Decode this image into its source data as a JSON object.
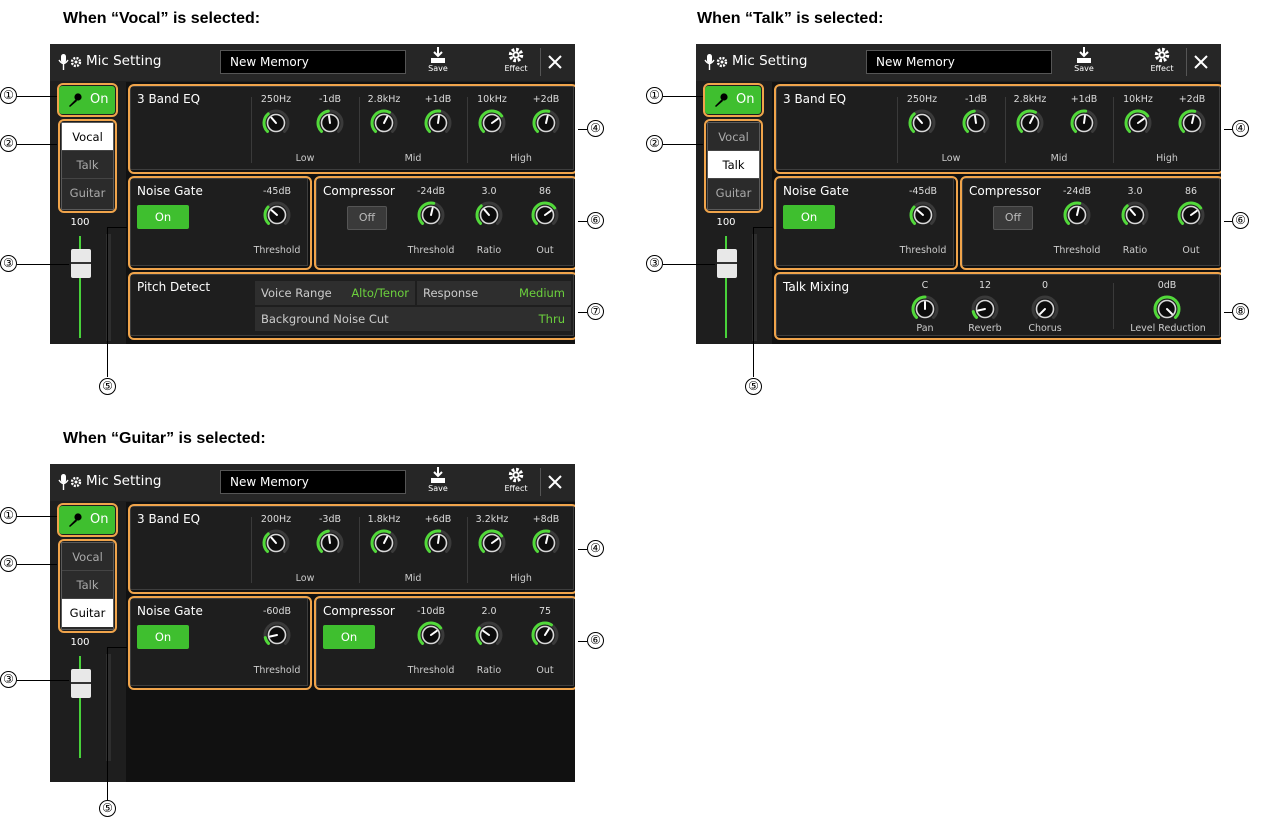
{
  "captions": {
    "vocal": "When “Vocal” is selected:",
    "talk": "When “Talk” is selected:",
    "guitar": "When “Guitar” is selected:"
  },
  "common": {
    "app_title": "Mic Setting",
    "memory_name": "New Memory",
    "save_label": "Save",
    "effect_label": "Effect",
    "mic_on_label": "On",
    "types": [
      "Vocal",
      "Talk",
      "Guitar"
    ],
    "volume_value": "100",
    "eq_title": "3 Band EQ",
    "eq_bands": [
      "Low",
      "Mid",
      "High"
    ],
    "noise_gate_title": "Noise Gate",
    "threshold_label": "Threshold",
    "compressor_title": "Compressor",
    "ratio_label": "Ratio",
    "out_label": "Out"
  },
  "callouts": [
    "①",
    "②",
    "③",
    "④",
    "⑤",
    "⑥",
    "⑦",
    "⑧"
  ],
  "screens": {
    "vocal": {
      "selected_type": "Vocal",
      "eq": [
        "250Hz",
        "-1dB",
        "2.8kHz",
        "+1dB",
        "10kHz",
        "+2dB"
      ],
      "noise_gate": {
        "state": "On",
        "threshold": "-45dB"
      },
      "compressor": {
        "state": "Off",
        "threshold": "-24dB",
        "ratio": "3.0",
        "out": "86"
      },
      "pitch_detect": {
        "title": "Pitch Detect",
        "voice_range_label": "Voice Range",
        "voice_range_value": "Alto/Tenor",
        "response_label": "Response",
        "response_value": "Medium",
        "noise_cut_label": "Background Noise Cut",
        "noise_cut_value": "Thru"
      }
    },
    "talk": {
      "selected_type": "Talk",
      "eq": [
        "250Hz",
        "-1dB",
        "2.8kHz",
        "+1dB",
        "10kHz",
        "+2dB"
      ],
      "noise_gate": {
        "state": "On",
        "threshold": "-45dB"
      },
      "compressor": {
        "state": "Off",
        "threshold": "-24dB",
        "ratio": "3.0",
        "out": "86"
      },
      "talk_mixing": {
        "title": "Talk Mixing",
        "pan": "C",
        "pan_label": "Pan",
        "reverb": "12",
        "reverb_label": "Reverb",
        "chorus": "0",
        "chorus_label": "Chorus",
        "level_reduction": "0dB",
        "level_reduction_label": "Level Reduction"
      }
    },
    "guitar": {
      "selected_type": "Guitar",
      "eq": [
        "200Hz",
        "-3dB",
        "1.8kHz",
        "+6dB",
        "3.2kHz",
        "+8dB"
      ],
      "noise_gate": {
        "state": "On",
        "threshold": "-60dB"
      },
      "compressor": {
        "state": "On",
        "threshold": "-10dB",
        "ratio": "2.0",
        "out": "75"
      }
    }
  },
  "colors": {
    "accent_green": "#3fbf2f",
    "highlight_orange": "#f0a44b",
    "screen_bg": "#1e1e1e"
  }
}
